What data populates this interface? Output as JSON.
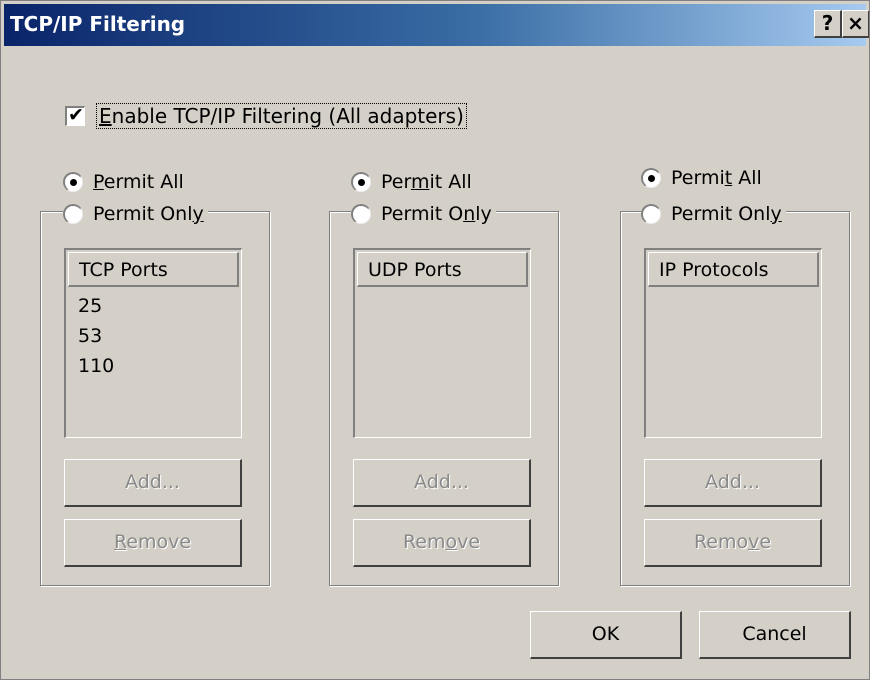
{
  "window": {
    "title": "TCP/IP Filtering",
    "help_button": "?",
    "close_button": "×"
  },
  "enable_filtering": {
    "checked": true,
    "check_mark": "✔",
    "label_accel": "E",
    "label_rest": "nable TCP/IP Filtering (All adapters)"
  },
  "panels": [
    {
      "permit_all": {
        "pre": "",
        "accel": "P",
        "post": "ermit All",
        "selected": true
      },
      "permit_only": {
        "pre": "Permit Onl",
        "accel": "y",
        "post": "",
        "selected": false
      },
      "list": {
        "header": "TCP Ports",
        "items": [
          "25",
          "53",
          "110"
        ]
      },
      "add_button": {
        "label": "Add...",
        "enabled": false
      },
      "remove_button": {
        "pre": "",
        "accel": "R",
        "post": "emove",
        "enabled": false
      }
    },
    {
      "permit_all": {
        "pre": "Per",
        "accel": "m",
        "post": "it All",
        "selected": true
      },
      "permit_only": {
        "pre": "Permit O",
        "accel": "n",
        "post": "ly",
        "selected": false
      },
      "list": {
        "header": "UDP Ports",
        "items": []
      },
      "add_button": {
        "label": "Add...",
        "enabled": false
      },
      "remove_button": {
        "pre": "Rem",
        "accel": "o",
        "post": "ve",
        "enabled": false
      }
    },
    {
      "permit_all": {
        "pre": "Permi",
        "accel": "t",
        "post": " All",
        "selected": true
      },
      "permit_only": {
        "pre": "Permit Onl",
        "accel": "y",
        "post": "",
        "selected": false
      },
      "list": {
        "header": "IP Protocols",
        "items": []
      },
      "add_button": {
        "label": "Add...",
        "enabled": false
      },
      "remove_button": {
        "pre": "Remo",
        "accel": "v",
        "post": "e",
        "enabled": false
      }
    }
  ],
  "footer": {
    "ok_label": "OK",
    "cancel_label": "Cancel"
  }
}
